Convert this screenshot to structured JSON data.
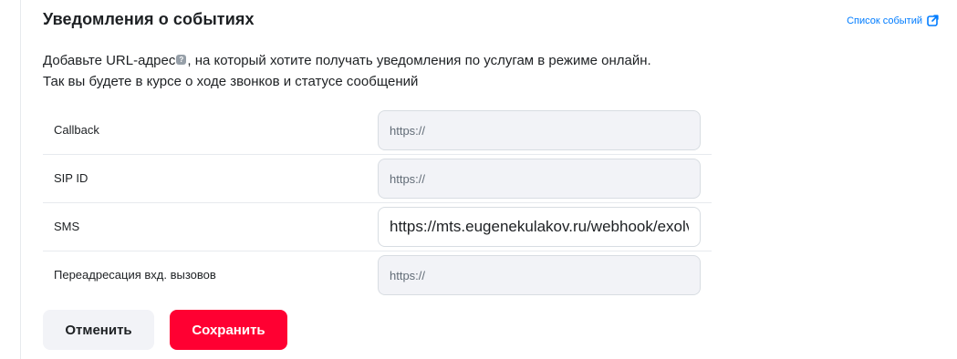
{
  "section": {
    "title": "Уведомления о событиях",
    "events_link_label": "Список событий",
    "description_part1": "Добавьте URL-адрес",
    "description_part2": ", на который хотите получать уведомления по услугам в режиме онлайн.",
    "description_line2": "Так вы будете в курсе о ходе звонков и статусе сообщений",
    "help_icon_glyph": "?"
  },
  "fields": [
    {
      "label": "Callback",
      "value": "",
      "placeholder": "https://"
    },
    {
      "label": "SIP ID",
      "value": "",
      "placeholder": "https://"
    },
    {
      "label": "SMS",
      "value": "https://mts.eugenekulakov.ru/webhook/exolve",
      "placeholder": "https://"
    },
    {
      "label": "Переадресация вхд. вызовов",
      "value": "",
      "placeholder": "https://"
    }
  ],
  "actions": {
    "cancel_label": "Отменить",
    "save_label": "Сохранить"
  },
  "colors": {
    "accent_link": "#007cff",
    "primary_button": "#ff0032",
    "secondary_button": "#f2f3f7",
    "input_background": "#f2f3f7"
  }
}
